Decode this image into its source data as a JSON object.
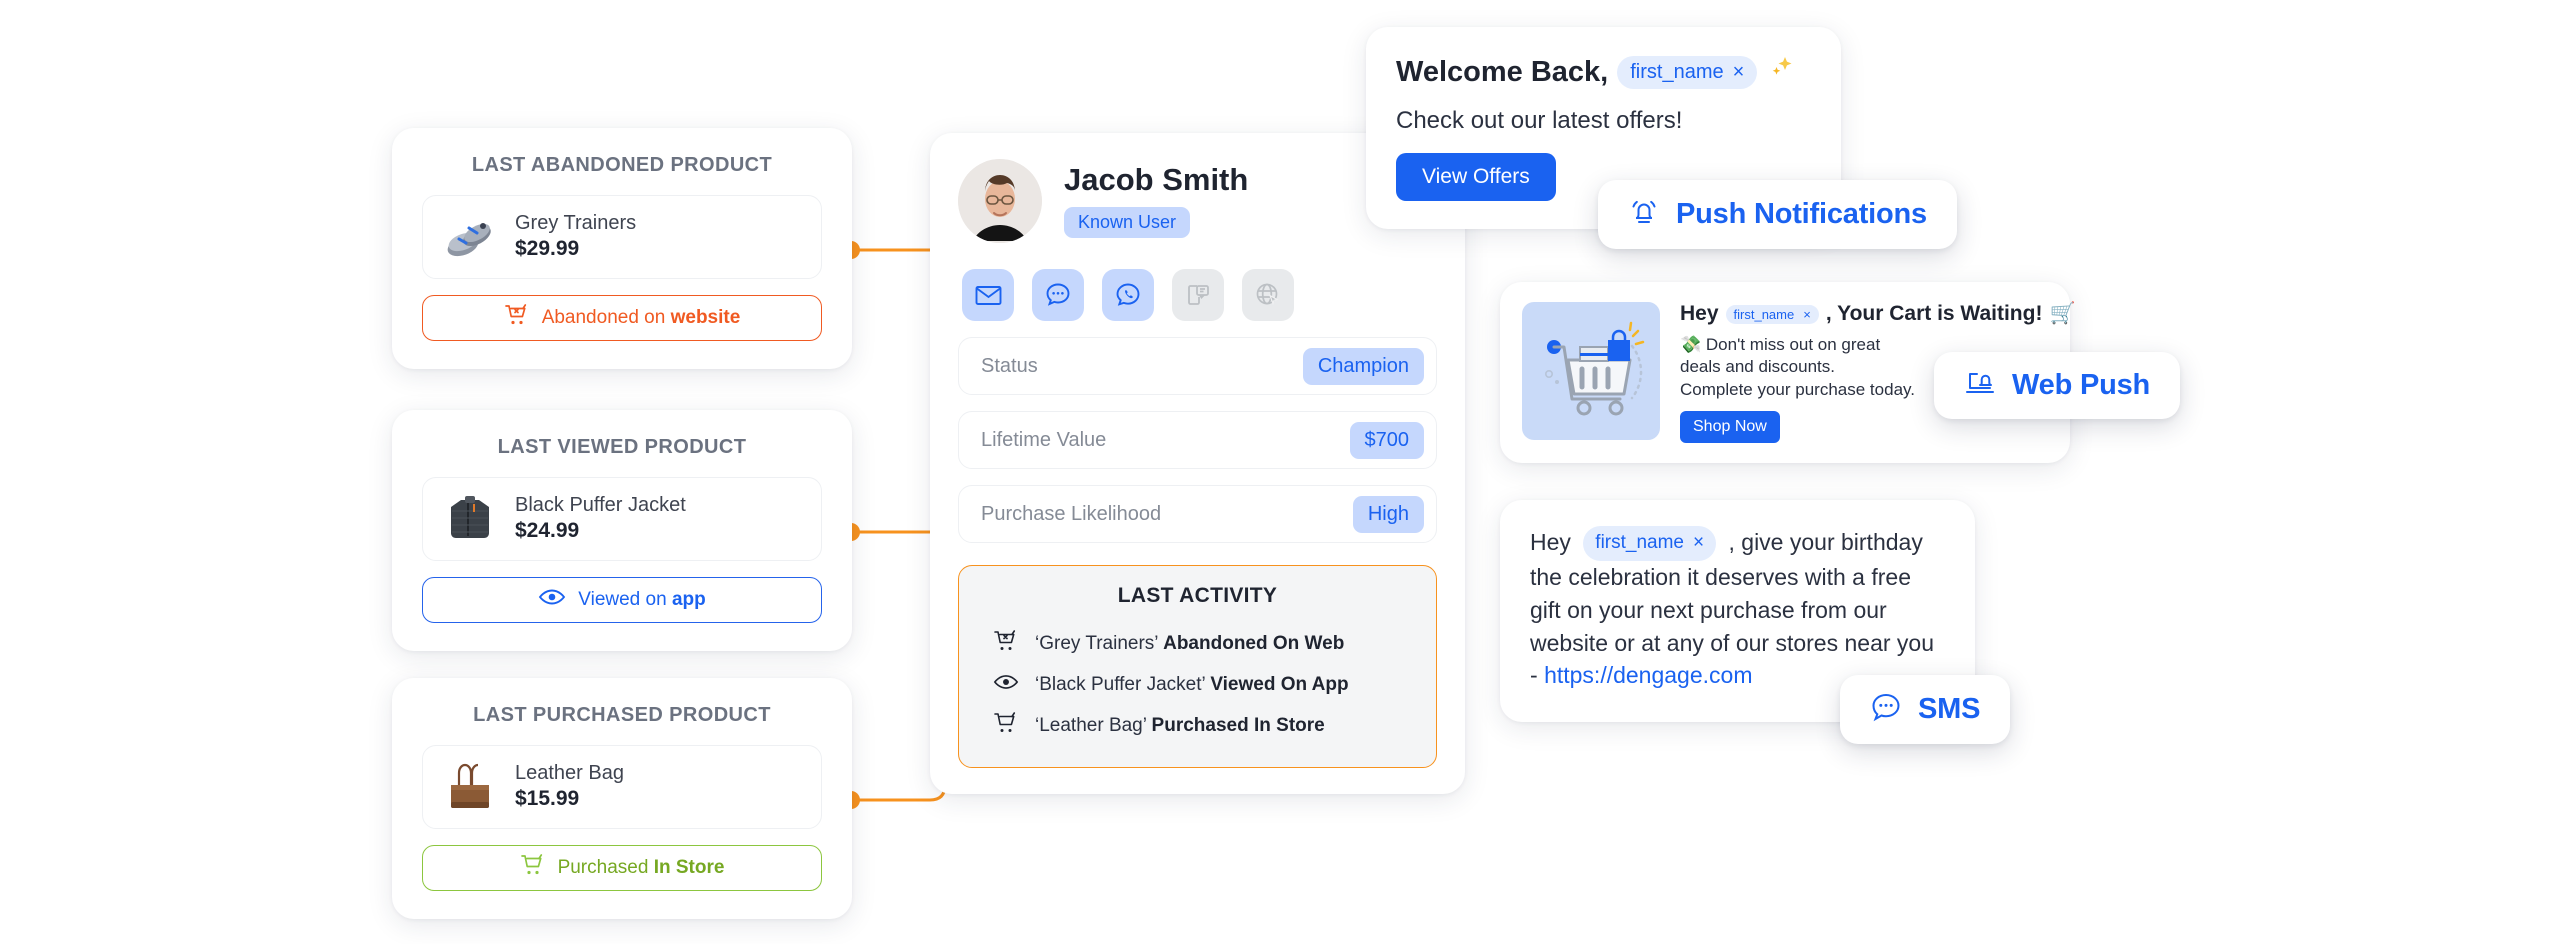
{
  "product_cards": [
    {
      "title": "LAST ABANDONED PRODUCT",
      "product_name": "Grey Trainers",
      "price": "$29.99",
      "thumb_icon": "grey-trainers-thumb",
      "action_text": "Abandoned on ",
      "action_bold": "website",
      "action_icon": "cart-x-icon",
      "accent": "#f05a22"
    },
    {
      "title": "LAST VIEWED PRODUCT",
      "product_name": "Black Puffer Jacket",
      "price": "$24.99",
      "thumb_icon": "black-puffer-jacket-thumb",
      "action_text": "Viewed on ",
      "action_bold": "app",
      "action_icon": "eye-icon",
      "accent": "#1a62f0"
    },
    {
      "title": "LAST PURCHASED PRODUCT",
      "product_name": "Leather Bag",
      "price": "$15.99",
      "thumb_icon": "leather-bag-thumb",
      "action_text": "Purchased ",
      "action_bold": "In Store",
      "action_icon": "cart-icon",
      "accent": "#8cc63f"
    }
  ],
  "profile": {
    "name": "Jacob Smith",
    "badge": "Known User",
    "avatar_alt": "jacob-smith-avatar",
    "channels": [
      {
        "name": "email-channel-icon",
        "active": true
      },
      {
        "name": "sms-channel-icon",
        "active": true
      },
      {
        "name": "whatsapp-channel-icon",
        "active": true
      },
      {
        "name": "mobile-push-channel-icon",
        "active": false
      },
      {
        "name": "web-push-channel-icon",
        "active": false
      }
    ],
    "stats": [
      {
        "label": "Status",
        "value": "Champion"
      },
      {
        "label": "Lifetime Value",
        "value": "$700"
      },
      {
        "label": "Purchase Likelihood",
        "value": "High"
      }
    ],
    "activity": {
      "title": "LAST ACTIVITY",
      "items": [
        {
          "icon": "cart-x-icon",
          "quoted": "‘Grey Trainers’",
          "bold": "Abandoned On Web"
        },
        {
          "icon": "eye-icon",
          "quoted": "‘Black Puffer Jacket’",
          "bold": "Viewed On App"
        },
        {
          "icon": "cart-icon",
          "quoted": "‘Leather Bag’",
          "bold": "Purchased In Store"
        }
      ]
    }
  },
  "welcome_card": {
    "heading_prefix": "Welcome Back,",
    "token": "first_name",
    "token_close": "×",
    "sparkle_icon": "sparkles-icon",
    "subtitle": "Check out our latest offers!",
    "button_label": "View Offers"
  },
  "badges": {
    "push_notifications": {
      "label": "Push Notifications",
      "icon": "bell-icon"
    },
    "web_push": {
      "label": "Web Push",
      "icon": "laptop-bell-icon"
    },
    "sms": {
      "label": "SMS",
      "icon": "chat-bubble-icon"
    }
  },
  "webpush_card": {
    "art_icon": "shopping-cart-illustration",
    "title_prefix": "Hey",
    "token": "first_name",
    "token_close": "×",
    "title_suffix": ", Your Cart is Waiting!",
    "title_emoji": "🛒",
    "body_emoji": "💸",
    "body_line1": "Don't miss out on great",
    "body_line2": "deals and discounts.",
    "body_line3": "Complete your purchase today.",
    "button_label": "Shop Now"
  },
  "sms_card": {
    "prefix": "Hey",
    "token": "first_name",
    "token_close": "×",
    "body": ", give your birthday the celebration it deserves with a free gift on your next purchase from our website or at any of our stores near you - ",
    "link": "https://dengage.com"
  },
  "colors": {
    "accent_blue": "#1a62f0",
    "accent_orange": "#f05a22",
    "accent_green": "#8cc63f",
    "connector_orange": "#f7921e"
  }
}
